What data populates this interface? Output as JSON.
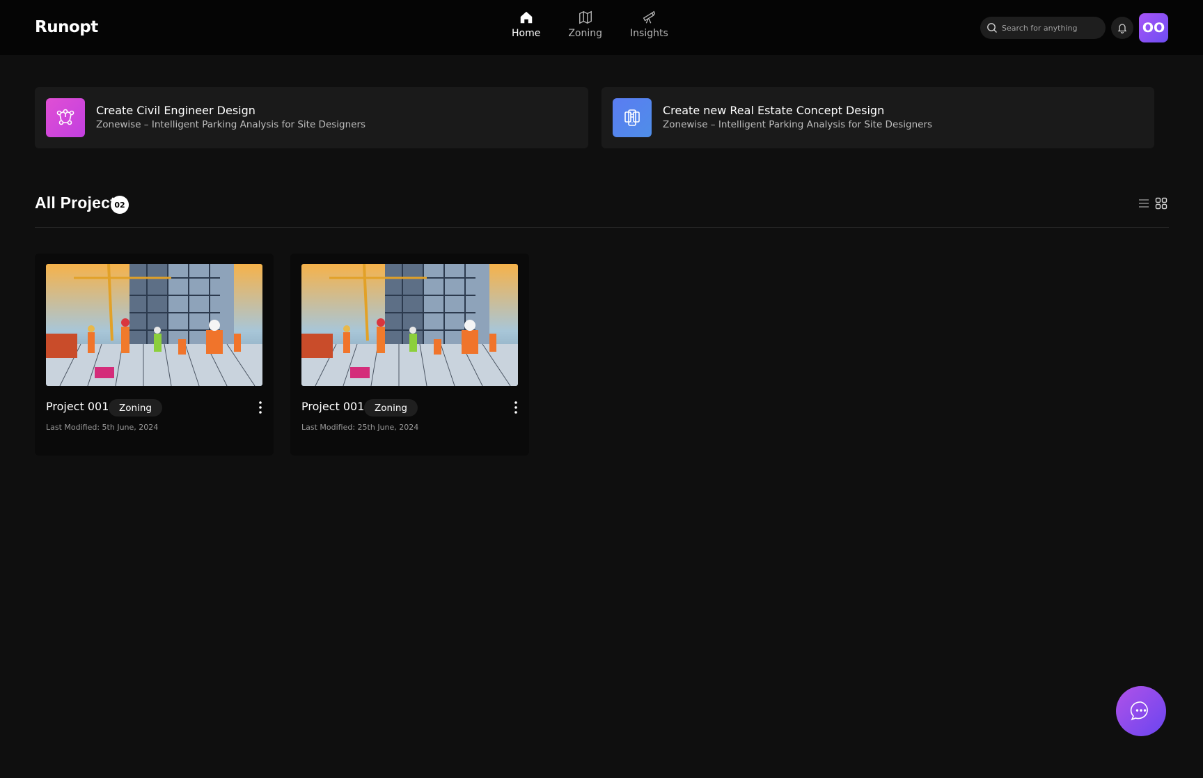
{
  "app": {
    "name": "Runopt"
  },
  "nav": {
    "items": [
      {
        "label": "Home",
        "icon": "home-icon",
        "active": true
      },
      {
        "label": "Zoning",
        "icon": "map-icon",
        "active": false
      },
      {
        "label": "Insights",
        "icon": "telescope-icon",
        "active": false
      }
    ]
  },
  "search": {
    "placeholder": "Search for anything",
    "value": ""
  },
  "user": {
    "initials": "OO"
  },
  "actions": [
    {
      "title": "Create Civil Engineer Design",
      "subtitle": "Zonewise – Intelligent Parking Analysis for Site Designers",
      "icon": "network-nodes-icon",
      "color": "#d94fd8"
    },
    {
      "title": "Create new Real Estate Concept Design",
      "subtitle": "Zonewise – Intelligent Parking Analysis for Site Designers",
      "icon": "building-devices-icon",
      "color": "#4f7cf0"
    }
  ],
  "projects_section": {
    "title": "All Project",
    "count": "02",
    "view_list_icon": "list-view-icon",
    "view_grid_icon": "grid-view-icon"
  },
  "projects": [
    {
      "name": "Project 001",
      "tag": "Zoning",
      "modified": "Last Modified: 5th June, 2024"
    },
    {
      "name": "Project 001",
      "tag": "Zoning",
      "modified": "Last Modified: 25th June, 2024"
    }
  ],
  "colors": {
    "background": "#0f0f0f",
    "topbar": "#050505",
    "card": "#1a1a1a",
    "accent_purple": "#8b5cf6"
  }
}
